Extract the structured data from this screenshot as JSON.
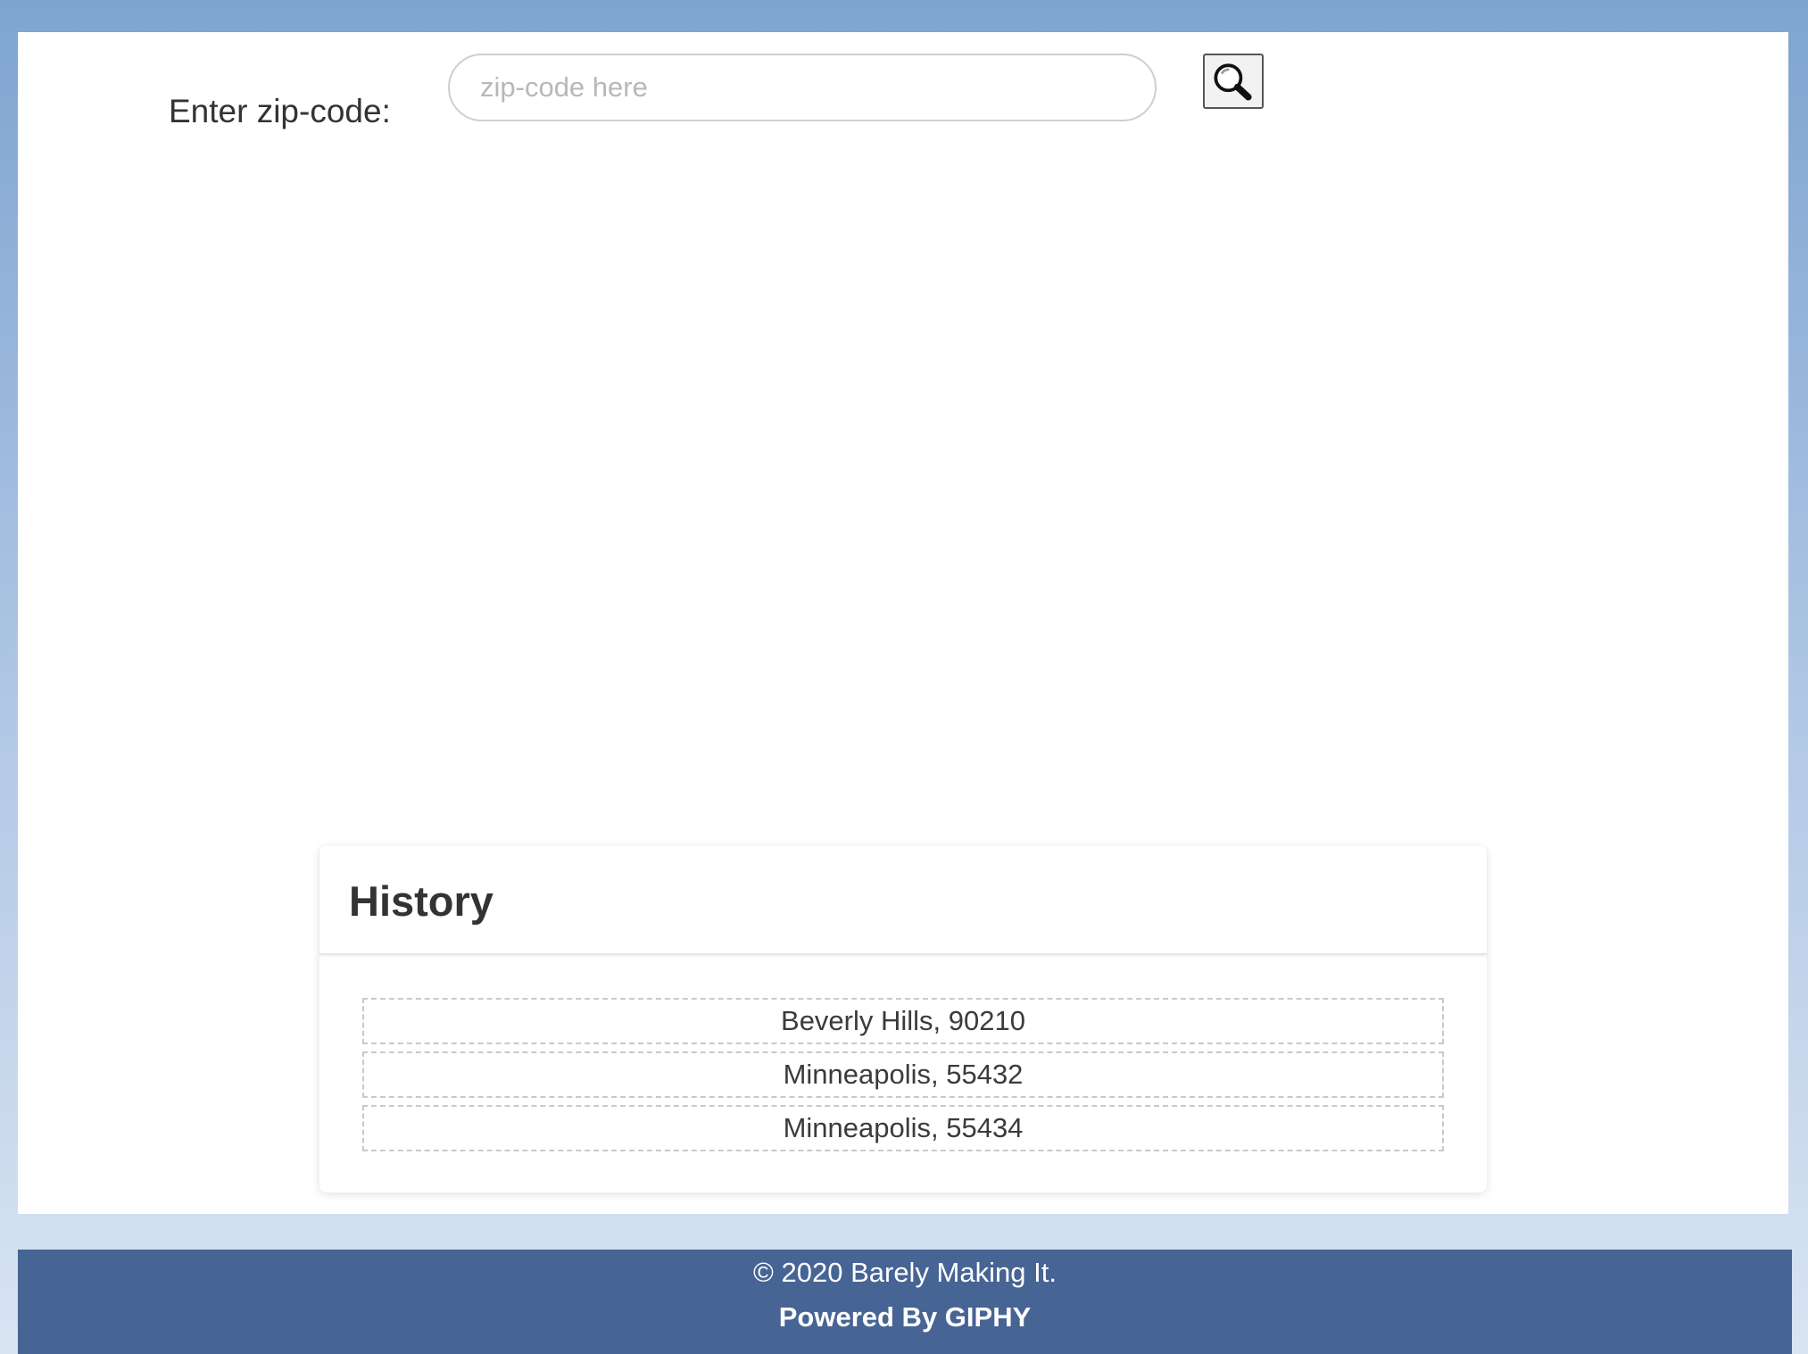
{
  "search": {
    "label": "Enter zip-code:",
    "placeholder": "zip-code here",
    "value": "",
    "button_icon": "magnifying-glass-icon"
  },
  "history": {
    "title": "History",
    "items": [
      "Beverly Hills, 90210",
      "Minneapolis, 55432",
      "Minneapolis, 55434"
    ]
  },
  "footer": {
    "copyright": "© 2020 Barely Making It.",
    "powered_by": "Powered By GIPHY"
  },
  "colors": {
    "footer_background": "#466494",
    "page_gradient_top": "#7ea4d0",
    "page_gradient_bottom": "#d9e4f2"
  }
}
